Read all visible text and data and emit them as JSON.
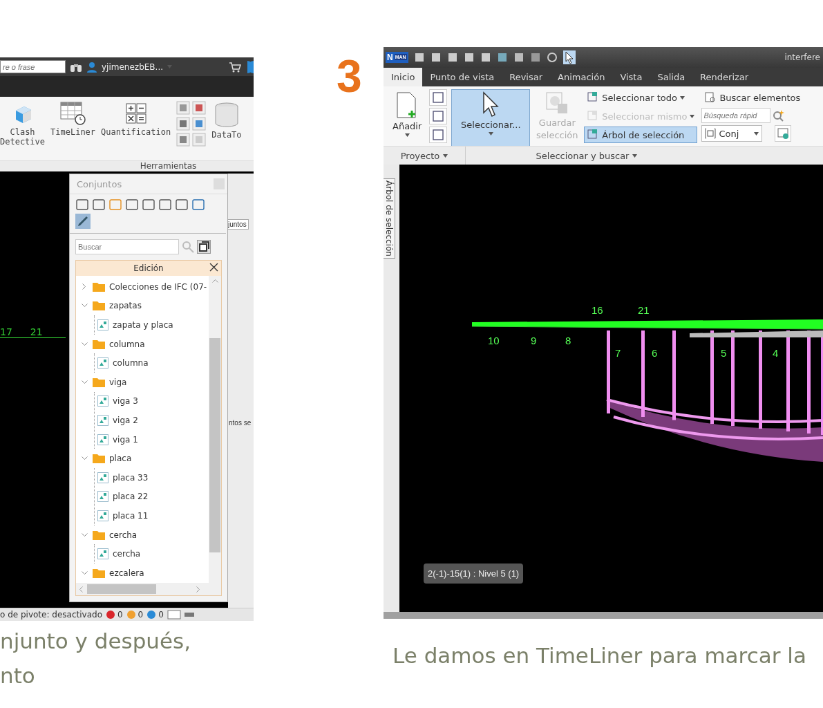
{
  "left_screenshot": {
    "top_bar": {
      "search": {
        "placeholder": "re o frase"
      },
      "user": "yjimenezbEB..."
    },
    "ribbon": {
      "tools": [
        {
          "label": "Clash Detective",
          "kind": "clash"
        },
        {
          "label": "TimeLiner",
          "kind": "timeliner"
        },
        {
          "label": "Quantification",
          "kind": "quantification"
        },
        {
          "kind": "small_grid"
        },
        {
          "label": "DataTo",
          "kind": "datatools"
        }
      ],
      "panel_label": "Herramientas"
    },
    "viewport": {
      "grid_labels": [
        "17",
        "21"
      ],
      "side_tab": "juntos",
      "side_text": "ntos se"
    },
    "sets_panel": {
      "title": "Conjuntos",
      "search": {
        "placeholder": "Buscar"
      },
      "edit_header": "Edición",
      "tree": [
        {
          "label": "Colecciones de IFC (07-",
          "kind": "folder",
          "expanded": false
        },
        {
          "label": "zapatas",
          "kind": "folder",
          "expanded": true,
          "children": [
            {
              "label": "zapata y placa",
              "kind": "set"
            }
          ]
        },
        {
          "label": "columna",
          "kind": "folder",
          "expanded": true,
          "children": [
            {
              "label": "columna",
              "kind": "set"
            }
          ]
        },
        {
          "label": "viga",
          "kind": "folder",
          "expanded": true,
          "children": [
            {
              "label": "viga 3",
              "kind": "set"
            },
            {
              "label": "viga 2",
              "kind": "set"
            },
            {
              "label": "viga 1",
              "kind": "set"
            }
          ]
        },
        {
          "label": "placa",
          "kind": "folder",
          "expanded": true,
          "children": [
            {
              "label": "placa 33",
              "kind": "set"
            },
            {
              "label": "placa 22",
              "kind": "set"
            },
            {
              "label": "placa 11",
              "kind": "set"
            }
          ]
        },
        {
          "label": "cercha",
          "kind": "folder",
          "expanded": true,
          "children": [
            {
              "label": "cercha",
              "kind": "set"
            }
          ]
        },
        {
          "label": "ezcalera",
          "kind": "folder",
          "expanded": true
        }
      ]
    },
    "status_bar": {
      "text": "o de pivote: desactivado",
      "counts": [
        {
          "value": "0",
          "color": "#d9262c"
        },
        {
          "value": "0",
          "color": "#f0a030"
        },
        {
          "value": "0",
          "color": "#2a8ad6"
        }
      ]
    }
  },
  "step_number": "3",
  "right_screenshot": {
    "title_bar": {
      "logo": [
        "N",
        "MAN"
      ],
      "title": "interfere"
    },
    "tabs": [
      {
        "label": "Inicio",
        "selected": true
      },
      {
        "label": "Punto de vista",
        "selected": false
      },
      {
        "label": "Revisar",
        "selected": false
      },
      {
        "label": "Animación",
        "selected": false
      },
      {
        "label": "Vista",
        "selected": false
      },
      {
        "label": "Salida",
        "selected": false
      },
      {
        "label": "Renderizar",
        "selected": false
      }
    ],
    "project_panel": {
      "label": "Proyecto",
      "add_button": {
        "label": "Añadir"
      }
    },
    "select_panel": {
      "label": "Seleccionar y buscar",
      "select_button": {
        "label": "Seleccionar...",
        "selected": true
      },
      "save_button": {
        "label": "Guardar selección",
        "disabled": true
      },
      "commands": [
        {
          "label": "Seleccionar todo",
          "disabled": false,
          "selected": false,
          "dropdown": true
        },
        {
          "label": "Seleccionar mismo",
          "disabled": true,
          "selected": false,
          "dropdown": true
        },
        {
          "label": "Árbol de selección",
          "disabled": false,
          "selected": true,
          "dropdown": false
        }
      ],
      "find_button": {
        "label": "Buscar elementos"
      },
      "quick_search": {
        "placeholder": "Búsqueda rápid"
      },
      "sets_dropdown": {
        "value": "Conj"
      }
    },
    "viewport": {
      "side_tab": "Árbol de selección",
      "grid_labels": [
        "16",
        "21",
        "10",
        "9",
        "8",
        "7",
        "6",
        "5",
        "4"
      ],
      "tooltip": "2(-1)-15(1) : Nivel 5 (1)"
    }
  },
  "captions": [
    {
      "lines": [
        "njunto y después,",
        "nto"
      ]
    },
    {
      "lines": [
        "Le damos en TimeLiner para marcar la"
      ]
    }
  ]
}
